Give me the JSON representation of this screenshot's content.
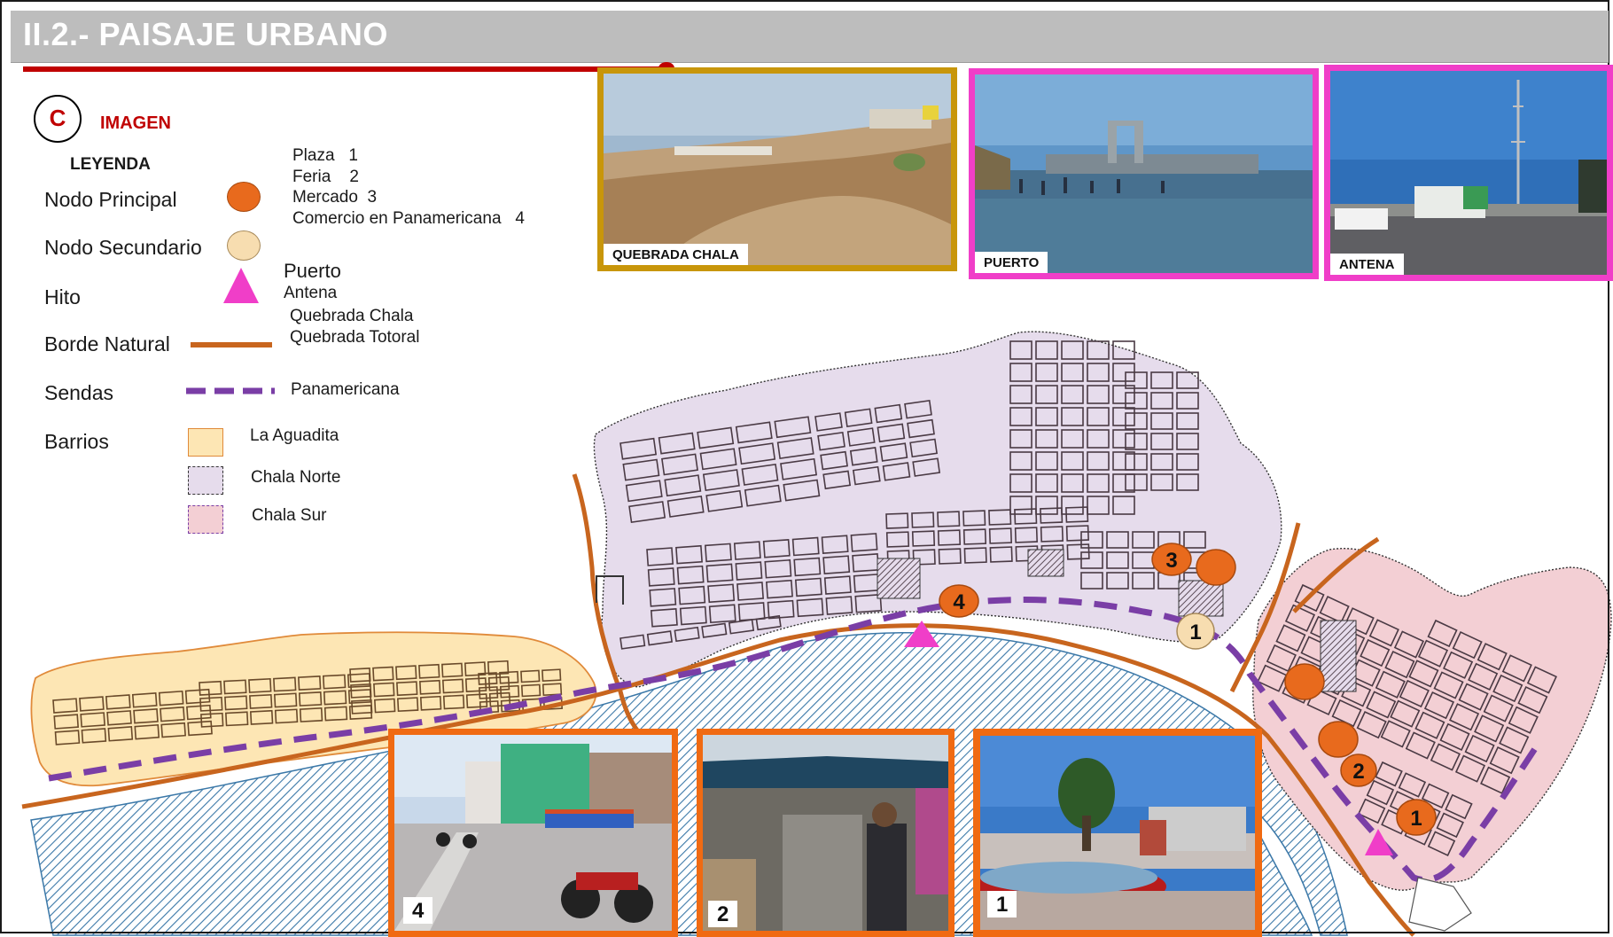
{
  "header": {
    "title": "II.2.- PAISAJE URBANO"
  },
  "legend": {
    "badge_letter": "C",
    "badge_caption": "IMAGEN",
    "heading": "LEYENDA",
    "rows": {
      "nodo_principal": "Nodo Principal",
      "nodo_secundario": "Nodo Secundario",
      "hito": "Hito",
      "borde_natural": "Borde Natural",
      "sendas": "Sendas",
      "barrios": "Barrios"
    },
    "nodes_list": [
      "Plaza   1",
      "Feria    2",
      "Mercado  3",
      "Comercio en Panamericana   4"
    ],
    "hitos_list": [
      "Puerto",
      "Antena"
    ],
    "bordes_list": [
      "Quebrada Chala",
      "Quebrada Totoral"
    ],
    "sendas_list": [
      "Panamericana"
    ],
    "barrios_list": [
      "La Aguadita",
      "Chala Norte",
      "Chala Sur"
    ]
  },
  "photos": {
    "quebrada_chala": "QUEBRADA CHALA",
    "puerto": "PUERTO",
    "antena": "ANTENA",
    "comercio": "4",
    "feria": "2",
    "plaza": "1"
  },
  "map_markers": {
    "mercado": "3",
    "comercio": "4",
    "plaza_norte": "1",
    "feria": "2",
    "plaza_sur": "1"
  },
  "colors": {
    "title_bar": "#bdbdbd",
    "accent_red": "#c00000",
    "nodo_principal": "#e86a1d",
    "nodo_secundario": "#f7ddb0",
    "hito": "#f03ec8",
    "borde_natural": "#c8651e",
    "sendas": "#7a3ea6",
    "la_aguadita": "#fde6b4",
    "chala_norte": "#e6dcec",
    "chala_sur": "#f3cfd4",
    "sea": "#3b78a8",
    "frame_quebrada": "#c8960a",
    "frame_pink": "#f03ec8",
    "frame_orange": "#f06a12"
  }
}
